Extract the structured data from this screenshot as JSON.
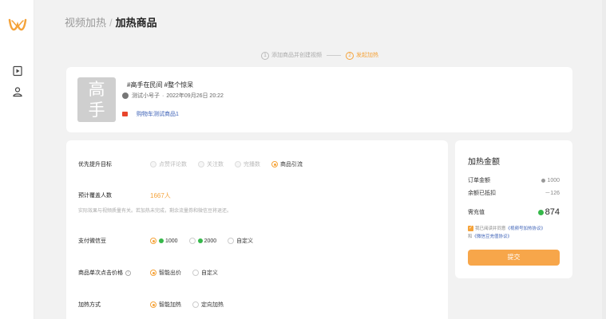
{
  "breadcrumb": {
    "parent": "视频加热",
    "separator": "/",
    "current": "加热商品"
  },
  "steps": [
    {
      "num": "1",
      "label": "添加商品并创建视频"
    },
    {
      "num": "2",
      "label": "发起加热"
    }
  ],
  "video": {
    "cover_text_top": "高",
    "cover_text_bottom": "手",
    "title": "#高手在民间 #整个惊呆",
    "author": "测试小号子",
    "dot": "·",
    "date": "2022年09月26日 20:22",
    "product": "购物车测试商品1"
  },
  "form": {
    "goal": {
      "label": "优先提升目标",
      "options": [
        "点赞评论数",
        "关注数",
        "完播数",
        "商品引流"
      ]
    },
    "coverage": {
      "label": "预计覆盖人数",
      "value": "1667人",
      "note": "实际效果与视频质量有关。若加热未完成，剩余流量券和微信豆将退还。"
    },
    "pay": {
      "label": "支付微信豆",
      "options": [
        "1000",
        "2000",
        "自定义"
      ]
    },
    "price": {
      "label": "商品单次点击价格",
      "info": "i",
      "options": [
        "智能出价",
        "自定义"
      ]
    },
    "method": {
      "label": "加热方式",
      "options": [
        "智能加热",
        "定向加热"
      ]
    }
  },
  "amount": {
    "title": "加热金额",
    "order_label": "订单金额",
    "order_value": "1000",
    "balance_label": "余额已抵扣",
    "balance_value": "－126",
    "need_label": "需充值",
    "need_value": "874",
    "agree_prefix": "我已阅读并同意",
    "agree_link1": "《视频号加热协议》",
    "agree_and": "和",
    "agree_link2": "《微信豆充值协议》",
    "pay_button": "提交"
  },
  "colors": {
    "accent": "#f5a33a",
    "link": "#3a5fb6",
    "coin": "#36b84a"
  }
}
